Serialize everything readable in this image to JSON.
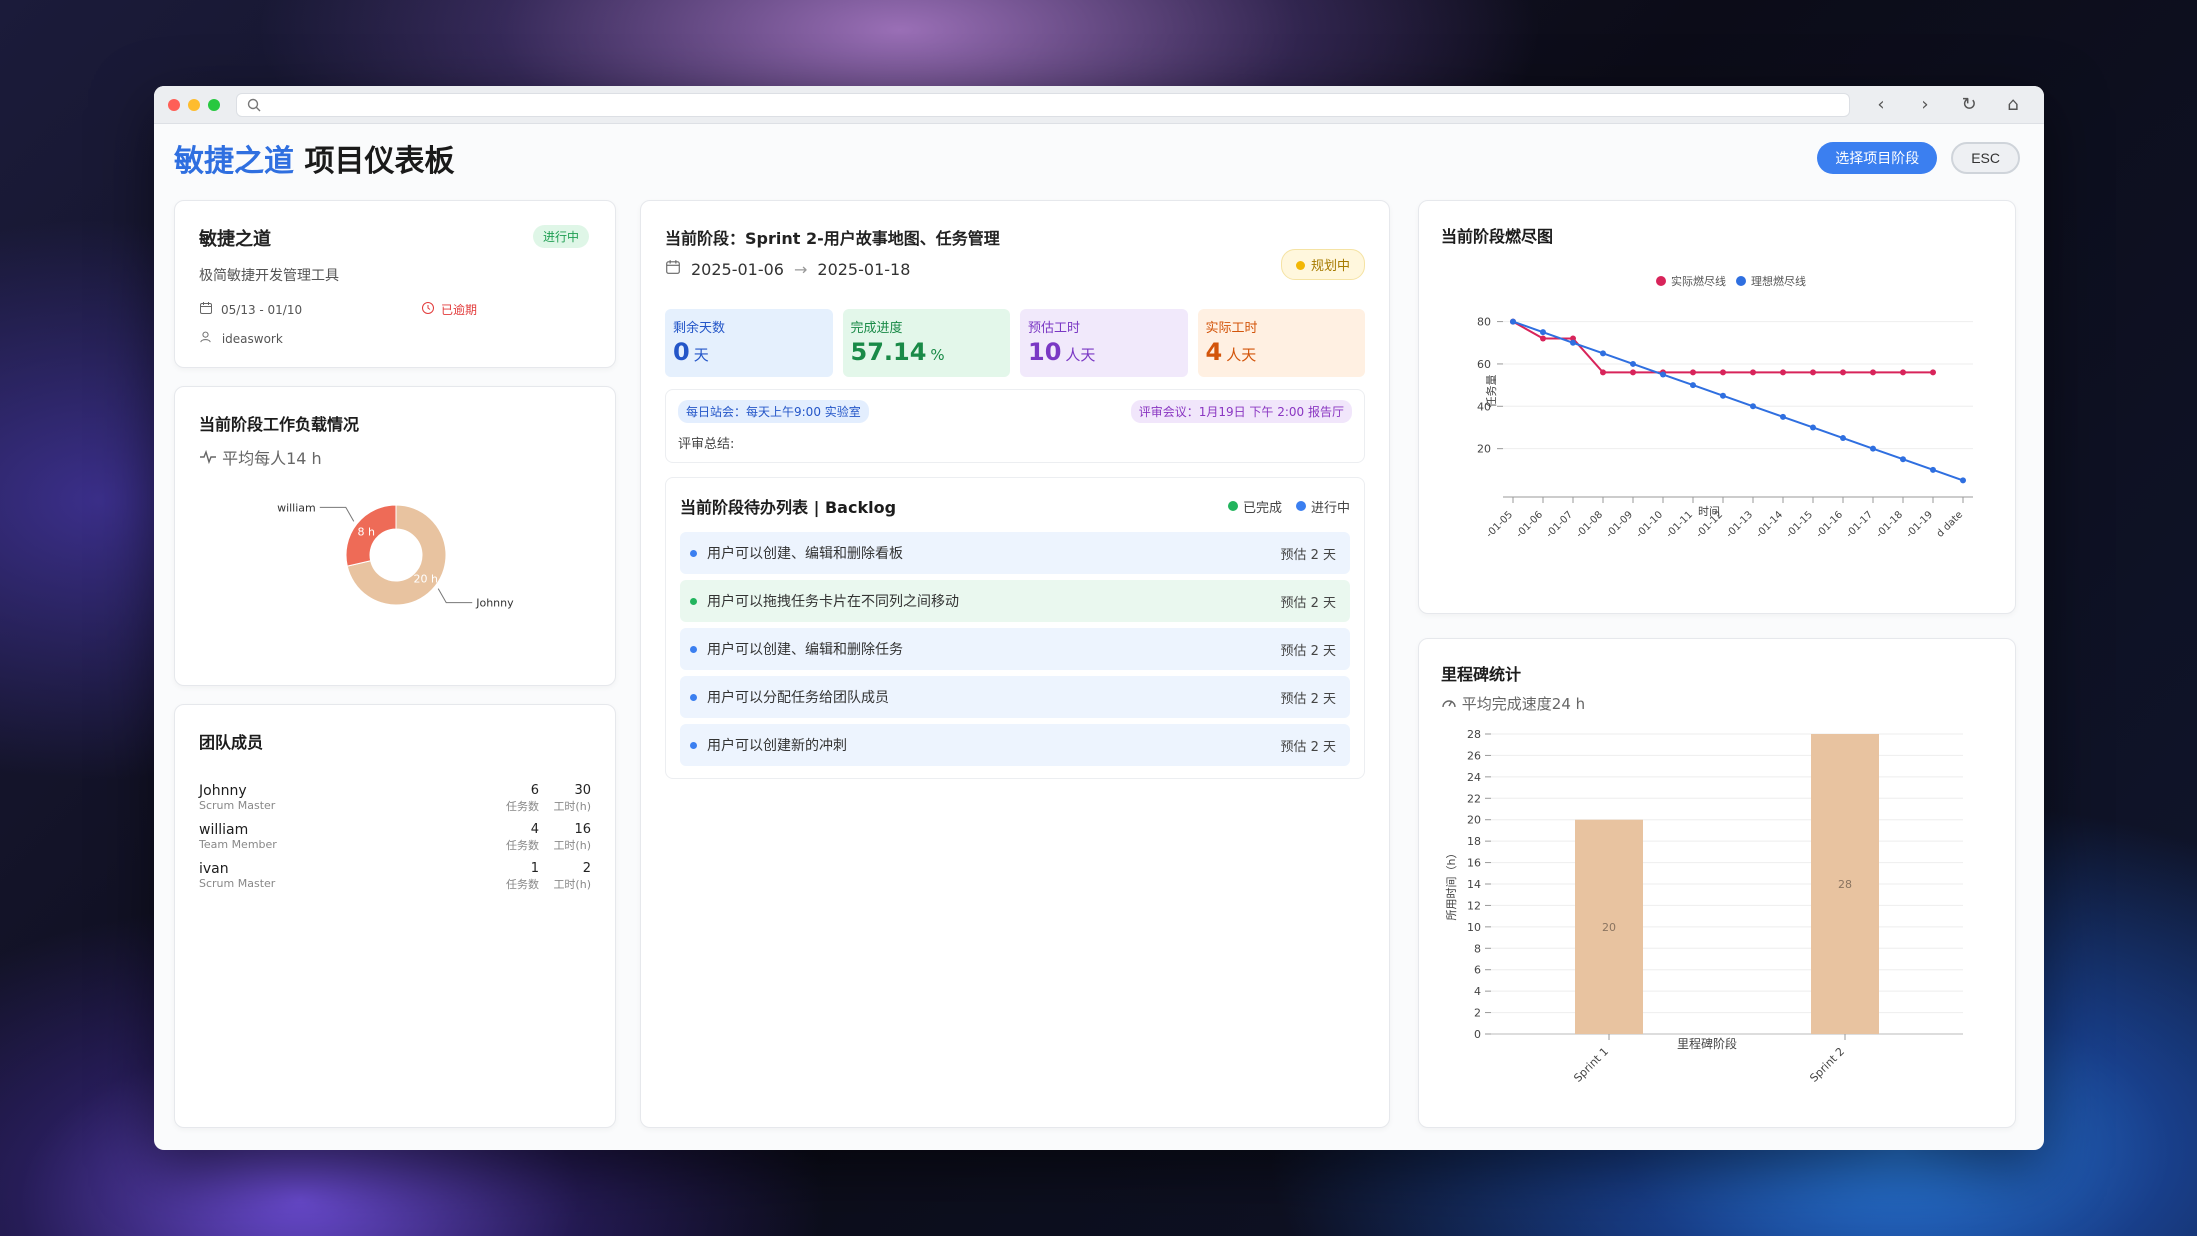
{
  "header": {
    "brand": "敏捷之道",
    "title": "项目仪表板",
    "select_phase": "选择项目阶段",
    "esc": "ESC"
  },
  "project": {
    "name": "敏捷之道",
    "status": "进行中",
    "description": "极简敏捷开发管理工具",
    "date_range": "05/13 - 01/10",
    "overdue": "已逾期",
    "owner": "ideaswork"
  },
  "workload": {
    "title": "当前阶段工作负载情况",
    "average": "平均每人14 h",
    "slices": [
      {
        "name": "william",
        "value": 8,
        "label": "8 h",
        "color": "#ee6b57"
      },
      {
        "name": "Johnny",
        "value": 20,
        "label": "20 h",
        "color": "#e8c3a0"
      }
    ]
  },
  "team": {
    "title": "团队成员",
    "task_label": "任务数",
    "hours_label": "工时(h)",
    "members": [
      {
        "name": "Johnny",
        "role": "Scrum Master",
        "tasks": "6",
        "hours": "30"
      },
      {
        "name": "william",
        "role": "Team Member",
        "tasks": "4",
        "hours": "16"
      },
      {
        "name": "ivan",
        "role": "Scrum Master",
        "tasks": "1",
        "hours": "2"
      }
    ]
  },
  "phase": {
    "title": "当前阶段：Sprint 2-用户故事地图、任务管理",
    "start": "2025-01-06",
    "end": "2025-01-18",
    "status": "规划中",
    "stats": [
      {
        "label": "剩余天数",
        "value": "0",
        "unit": "天"
      },
      {
        "label": "完成进度",
        "value": "57.14",
        "unit": "%"
      },
      {
        "label": "预估工时",
        "value": "10",
        "unit": "人天"
      },
      {
        "label": "实际工时",
        "value": "4",
        "unit": "人天"
      }
    ],
    "standup": "每日站会：每天上午9:00 实验室",
    "review": "评审会议：1月19日 下午 2:00 报告厅",
    "review_summary": "评审总结:"
  },
  "backlog": {
    "title": "当前阶段待办列表 | Backlog",
    "legend_done": "已完成",
    "legend_doing": "进行中",
    "items": [
      {
        "text": "用户可以创建、编辑和删除看板",
        "estimate": "预估 2 天"
      },
      {
        "text": "用户可以拖拽任务卡片在不同列之间移动",
        "estimate": "预估 2 天"
      },
      {
        "text": "用户可以创建、编辑和删除任务",
        "estimate": "预估 2 天"
      },
      {
        "text": "用户可以分配任务给团队成员",
        "estimate": "预估 2 天"
      },
      {
        "text": "用户可以创建新的冲刺",
        "estimate": "预估 2 天"
      }
    ]
  },
  "burndown": {
    "title": "当前阶段燃尽图"
  },
  "milestone": {
    "title": "里程碑统计",
    "average": "平均完成速度24 h"
  },
  "chart_data": [
    {
      "type": "line",
      "x": [
        "2025-01-05",
        "2025-01-06",
        "2025-01-07",
        "2025-01-08",
        "2025-01-09",
        "2025-01-10",
        "2025-01-11",
        "2025-01-12",
        "2025-01-13",
        "2025-01-14",
        "2025-01-15",
        "2025-01-16",
        "2025-01-17",
        "2025-01-18",
        "2025-01-19",
        "end date"
      ],
      "tick_labels": [
        "-01-05",
        "-01-06",
        "-01-07",
        "-01-08",
        "-01-09",
        "-01-10",
        "-01-11",
        "-01-12",
        "-01-13",
        "-01-14",
        "-01-15",
        "-01-16",
        "-01-17",
        "-01-18",
        "-01-19",
        "d date"
      ],
      "series": [
        {
          "name": "实际燃尽线",
          "color": "#d8245a",
          "values": [
            80,
            72,
            72,
            56,
            56,
            56,
            56,
            56,
            56,
            56,
            56,
            56,
            56,
            56,
            56,
            null
          ]
        },
        {
          "name": "理想燃尽线",
          "color": "#2f6fe0",
          "values": [
            80,
            75,
            70,
            65,
            60,
            55,
            50,
            45,
            40,
            35,
            30,
            25,
            20,
            15,
            10,
            5
          ]
        }
      ],
      "xlabel": "时间",
      "ylabel": "任务量",
      "ylim": [
        0,
        85
      ],
      "yticks": [
        20,
        40,
        60,
        80
      ],
      "legend": "top"
    },
    {
      "type": "bar",
      "categories": [
        "Sprint 1",
        "Sprint 2"
      ],
      "values": [
        20,
        28
      ],
      "color": "#e8c3a0",
      "xlabel": "里程碑阶段",
      "ylabel": "所用时间（h）",
      "ylim": [
        0,
        28
      ],
      "yticks": [
        0,
        2,
        4,
        6,
        8,
        10,
        12,
        14,
        16,
        18,
        20,
        22,
        24,
        26,
        28
      ]
    }
  ]
}
